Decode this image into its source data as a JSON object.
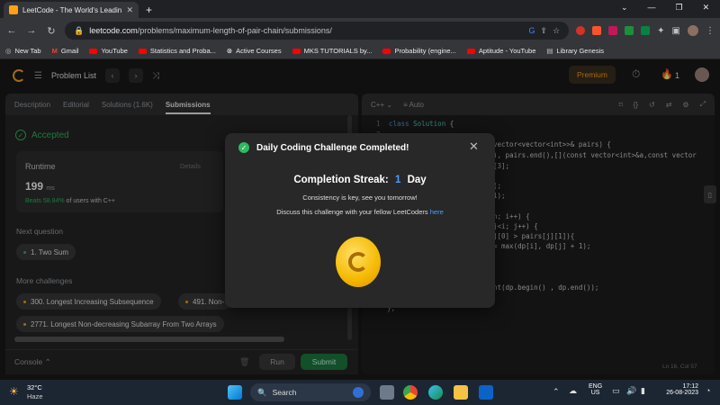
{
  "browser": {
    "tab_title": "LeetCode - The World's Leading",
    "url_host": "leetcode.com",
    "url_path": "/problems/maximum-length-of-pair-chain/submissions/"
  },
  "bookmarks": [
    "New Tab",
    "Gmail",
    "YouTube",
    "Statistics and Proba...",
    "Active Courses",
    "MKS TUTORIALS by...",
    "Probability (engine...",
    "Aptitude - YouTube",
    "Library Genesis"
  ],
  "header": {
    "problem_list": "Problem List",
    "premium": "Premium",
    "streak_count": "1"
  },
  "left": {
    "tabs": [
      "Description",
      "Editorial",
      "Solutions (1.6K)",
      "Submissions"
    ],
    "accepted": "Accepted",
    "runtime_label": "Runtime",
    "details": "Details",
    "runtime_value": "199",
    "runtime_unit": "ms",
    "beats_pct": "Beats 58.84%",
    "beats_rest": "of users with C++",
    "next_question_label": "Next question",
    "next_question": "1. Two Sum",
    "more_label": "More challenges",
    "challenge1": "300. Longest Increasing Subsequence",
    "challenge2": "491. Non-",
    "challenge3": "2771. Longest Non-decreasing Subarray From Two Arrays",
    "console": "Console",
    "run": "Run",
    "submit": "Submit"
  },
  "editor": {
    "lang": "C++",
    "auto": "Auto",
    "lines": [
      {
        "n": "1",
        "pre": "class ",
        "kw": "Solution",
        "post": " {"
      },
      {
        "n": "2",
        "pre": "",
        "kw": "",
        "post": ""
      }
    ],
    "frag_a": "vector<vector<int>>& pairs) {",
    "frag_b": "), pairs.end(),[](const vector<int>&a,const vector",
    "frag_c": "[3];",
    "frag_d": "(;",
    "frag_e": "1);",
    "frag_f": "n; i++) {",
    "frag_g": "j<i; j++) {",
    "frag_h": "][0] > pairs[j][1]){",
    "frag_i": "= max(dp[i], dp[j] + 1);",
    "frag_j": "nt(dp.begin() , dp.end());",
    "frag_k": "};",
    "status": "Ln 16, Col 57"
  },
  "modal": {
    "title": "Daily Coding Challenge Completed!",
    "streak_label": "Completion Streak:",
    "streak_num": "1",
    "streak_unit": "Day",
    "line1": "Consistency is key, see you tomorrow!",
    "line2": "Discuss this challenge with your fellow LeetCoders",
    "link": "here"
  },
  "taskbar": {
    "temp": "32°C",
    "weather": "Haze",
    "search": "Search",
    "lang1": "ENG",
    "lang2": "US",
    "time": "17:12",
    "date": "26-08-2023"
  },
  "colors": {
    "accent": "#ffa116",
    "success": "#2cbb5d",
    "link": "#4a9eff"
  }
}
